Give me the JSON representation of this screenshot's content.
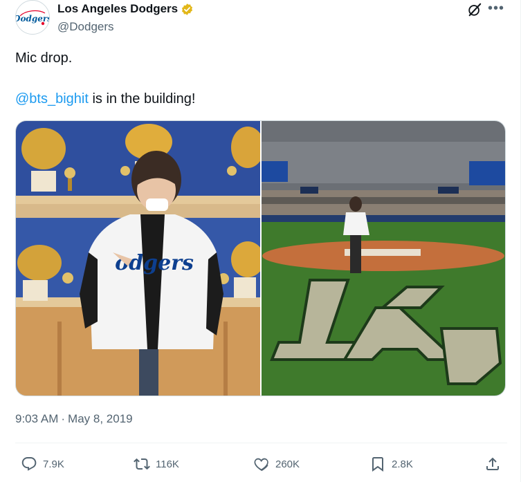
{
  "author": {
    "display_name": "Los Angeles Dodgers",
    "handle": "@Dodgers",
    "avatar_text": "Dodgers",
    "verified_color": "#e2b719"
  },
  "tweet": {
    "line1": "Mic drop.",
    "mention": "@bts_bighit",
    "line2_rest": " is in the building!"
  },
  "media": {
    "images": [
      {
        "name": "jersey-photo-trophy-room"
      },
      {
        "name": "stadium-field-photo"
      }
    ]
  },
  "timestamp": {
    "time": "9:03 AM",
    "separator": "·",
    "date": "May 8, 2019"
  },
  "actions": {
    "replies": "7.9K",
    "reposts": "116K",
    "likes": "260K",
    "bookmarks": "2.8K"
  },
  "colors": {
    "accent": "#1d9bf0",
    "secondary_text": "#536471",
    "dodger_blue": "#005a9c"
  },
  "icons": [
    "grok-icon",
    "more-icon",
    "reply-icon",
    "repost-icon",
    "like-icon",
    "bookmark-icon",
    "share-icon"
  ]
}
